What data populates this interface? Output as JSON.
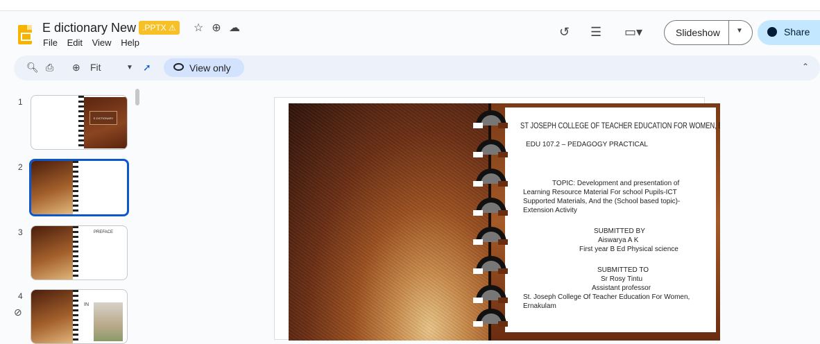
{
  "header": {
    "doc_title": "E dictionary New",
    "badge": ".PPTX",
    "badge_icon": "warning-icon",
    "menu": [
      "File",
      "Edit",
      "View",
      "Help"
    ],
    "slideshow_label": "Slideshow",
    "share_label": "Share"
  },
  "toolbar": {
    "zoom": "Fit",
    "view_only_label": "View only"
  },
  "filmstrip": {
    "slides": [
      {
        "number": "1",
        "thumb_text": "E-DICTIONARY"
      },
      {
        "number": "2",
        "thumb_text": ""
      },
      {
        "number": "3",
        "thumb_text": "PREFACE"
      },
      {
        "number": "4",
        "thumb_text": "IN"
      }
    ]
  },
  "slide": {
    "title": "ST JOSEPH COLLEGE OF TEACHER EDUCATION FOR WOMEN, ERNAKULAM",
    "course": "EDU 107.2 – PEDAGOGY PRACTICAL",
    "topic_l1": "TOPIC: Development and presentation of",
    "topic_l2": "Learning Resource Material For school Pupils-ICT",
    "topic_l3": "Supported Materials, And the (School based topic)-",
    "topic_l4": "Extension Activity",
    "submitted_by_label": "SUBMITTED BY",
    "submitted_by_name": "Aiswarya A K",
    "submitted_by_detail": "First year B Ed Physical science",
    "submitted_to_label": "SUBMITTED TO",
    "submitted_to_name": "Sr Rosy Tintu",
    "submitted_to_role": "Assistant professor",
    "submitted_to_inst_l1": "St. Joseph College Of Teacher Education For Women,",
    "submitted_to_inst_l2": "Ernakulam"
  }
}
